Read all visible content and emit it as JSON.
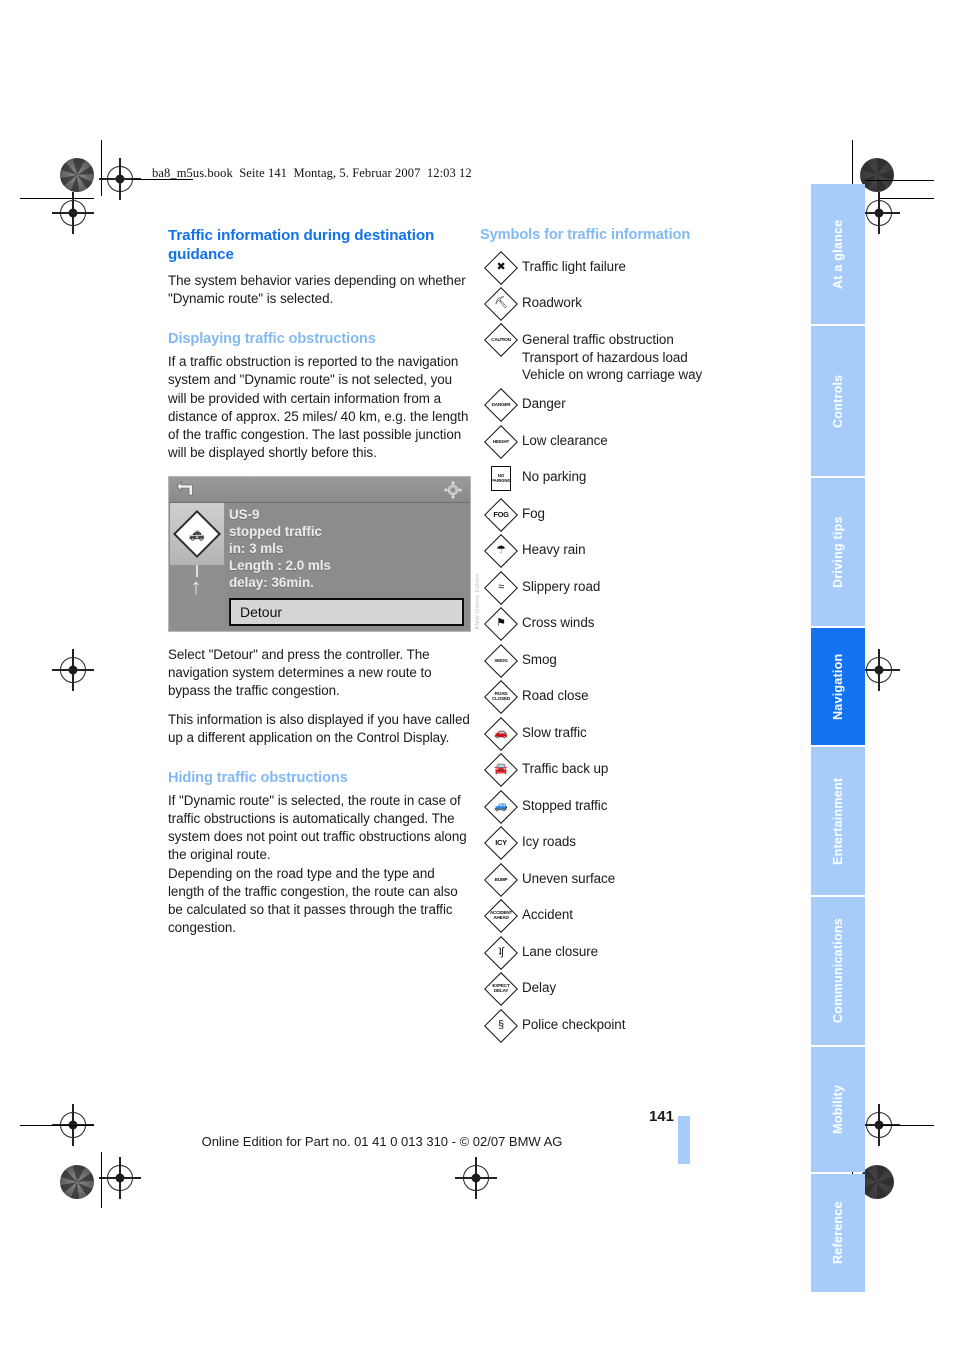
{
  "file_header": "ba8_m5us.book  Seite 141  Montag, 5. Februar 2007  12:03 12",
  "left_column": {
    "section_title": "Traffic information during destination guidance",
    "intro": "The system behavior varies depending on whether \"Dynamic route\" is selected.",
    "sub1_title": "Displaying traffic obstructions",
    "sub1_body": "If a traffic obstruction is reported to the navigation system and \"Dynamic route\" is not selected, you will be provided with certain information from a distance of approx. 25 miles/ 40 km, e.g. the length of the traffic congestion. The last possible junction will be displayed shortly before this.",
    "after_fig_1": "Select \"Detour\" and press the controller. The navigation system determines a new route to bypass the traffic congestion.",
    "after_fig_2": "This information is also displayed if you have called up a different application on the Control Display.",
    "sub2_title": "Hiding traffic obstructions",
    "sub2_body_1": "If \"Dynamic route\" is selected, the route in case of traffic obstructions is automatically changed. The system does not point out traffic obstructions along the original route.",
    "sub2_body_2": "Depending on the road type and the type and length of the traffic congestion, the route can also be calculated so that it passes through the traffic congestion."
  },
  "nav_figure": {
    "road": "US-9",
    "status": "stopped traffic",
    "distance": "in: 3 mls",
    "length": "Length : 2.0 mls",
    "delay": "delay: 36min.",
    "button": "Detour",
    "back_icon": "back-arrow-icon",
    "gear_icon": "settings-gear-icon",
    "symbol_icon": "stopped-traffic-diamond-icon",
    "arrow_icon": "straight-ahead-arrow-icon",
    "watermark": "BMW Online Edition"
  },
  "right_column": {
    "section_title": "Symbols for traffic information",
    "symbols": [
      {
        "icon": "traffic-light-failure-sign",
        "sign": "diamond",
        "glyph": "✖",
        "glyph_class": "sym",
        "labels": [
          "Traffic light failure"
        ]
      },
      {
        "icon": "roadwork-sign",
        "sign": "diamond",
        "glyph": "⛏",
        "glyph_class": "sym",
        "labels": [
          "Roadwork"
        ]
      },
      {
        "icon": "caution-sign",
        "sign": "diamond",
        "glyph": "CAUTION",
        "glyph_class": "",
        "labels": [
          "General traffic obstruction",
          "Transport of hazardous load",
          "Vehicle on wrong carriage way"
        ]
      },
      {
        "icon": "danger-sign",
        "sign": "diamond",
        "glyph": "DANGER",
        "glyph_class": "",
        "labels": [
          "Danger"
        ]
      },
      {
        "icon": "low-clearance-sign",
        "sign": "diamond",
        "glyph": "HEIGHT",
        "glyph_class": "",
        "labels": [
          "Low clearance"
        ]
      },
      {
        "icon": "no-parking-sign",
        "sign": "rect",
        "glyph": "NO|PARKING",
        "glyph_class": "",
        "labels": [
          "No parking"
        ]
      },
      {
        "icon": "fog-sign",
        "sign": "diamond",
        "glyph": "FOG",
        "glyph_class": "big",
        "labels": [
          "Fog"
        ]
      },
      {
        "icon": "heavy-rain-sign",
        "sign": "diamond",
        "glyph": "☂",
        "glyph_class": "sym",
        "labels": [
          "Heavy rain"
        ]
      },
      {
        "icon": "slippery-road-sign",
        "sign": "diamond",
        "glyph": "≈",
        "glyph_class": "sym",
        "labels": [
          "Slippery road"
        ]
      },
      {
        "icon": "cross-winds-sign",
        "sign": "diamond",
        "glyph": "⚑",
        "glyph_class": "sym",
        "labels": [
          "Cross winds"
        ]
      },
      {
        "icon": "smog-sign",
        "sign": "diamond",
        "glyph": "SMOG",
        "glyph_class": "",
        "labels": [
          "Smog"
        ]
      },
      {
        "icon": "road-close-sign",
        "sign": "diamond",
        "glyph": "ROAD|CLOSED",
        "glyph_class": "",
        "labels": [
          "Road close"
        ]
      },
      {
        "icon": "slow-traffic-sign",
        "sign": "diamond",
        "glyph": "🚗",
        "glyph_class": "sym",
        "labels": [
          "Slow traffic"
        ]
      },
      {
        "icon": "traffic-back-up-sign",
        "sign": "diamond",
        "glyph": "🚘",
        "glyph_class": "sym",
        "labels": [
          "Traffic back up"
        ]
      },
      {
        "icon": "stopped-traffic-sign",
        "sign": "diamond",
        "glyph": "🚙",
        "glyph_class": "sym",
        "labels": [
          "Stopped traffic"
        ]
      },
      {
        "icon": "icy-roads-sign",
        "sign": "diamond",
        "glyph": "ICY",
        "glyph_class": "big",
        "labels": [
          "Icy roads"
        ]
      },
      {
        "icon": "uneven-surface-sign",
        "sign": "diamond",
        "glyph": "BUMP",
        "glyph_class": "",
        "labels": [
          "Uneven surface"
        ]
      },
      {
        "icon": "accident-sign",
        "sign": "diamond",
        "glyph": "ACCIDENT|AHEAD",
        "glyph_class": "",
        "labels": [
          "Accident"
        ]
      },
      {
        "icon": "lane-closure-sign",
        "sign": "diamond",
        "glyph": "ʇʃ",
        "glyph_class": "sym",
        "labels": [
          "Lane closure"
        ]
      },
      {
        "icon": "delay-sign",
        "sign": "diamond",
        "glyph": "EXPECT|DELAY",
        "glyph_class": "",
        "labels": [
          "Delay"
        ]
      },
      {
        "icon": "police-checkpoint-sign",
        "sign": "diamond",
        "glyph": "§",
        "glyph_class": "sym",
        "labels": [
          "Police checkpoint"
        ]
      }
    ]
  },
  "sidebar_tabs": [
    {
      "label": "At a glance",
      "active": false
    },
    {
      "label": "Controls",
      "active": false
    },
    {
      "label": "Driving tips",
      "active": false
    },
    {
      "label": "Navigation",
      "active": true
    },
    {
      "label": "Entertainment",
      "active": false
    },
    {
      "label": "Communications",
      "active": false
    },
    {
      "label": "Mobility",
      "active": false
    },
    {
      "label": "Reference",
      "active": false
    }
  ],
  "footer": {
    "page_number": "141",
    "text": "Online Edition for Part no. 01 41 0 013 310 - © 02/07 BMW AG"
  },
  "colors": {
    "heading_blue": "#1272e8",
    "subheading_blue": "#83b9f2",
    "tab_inactive": "#a8ccfa",
    "tab_active": "#1272f0"
  }
}
